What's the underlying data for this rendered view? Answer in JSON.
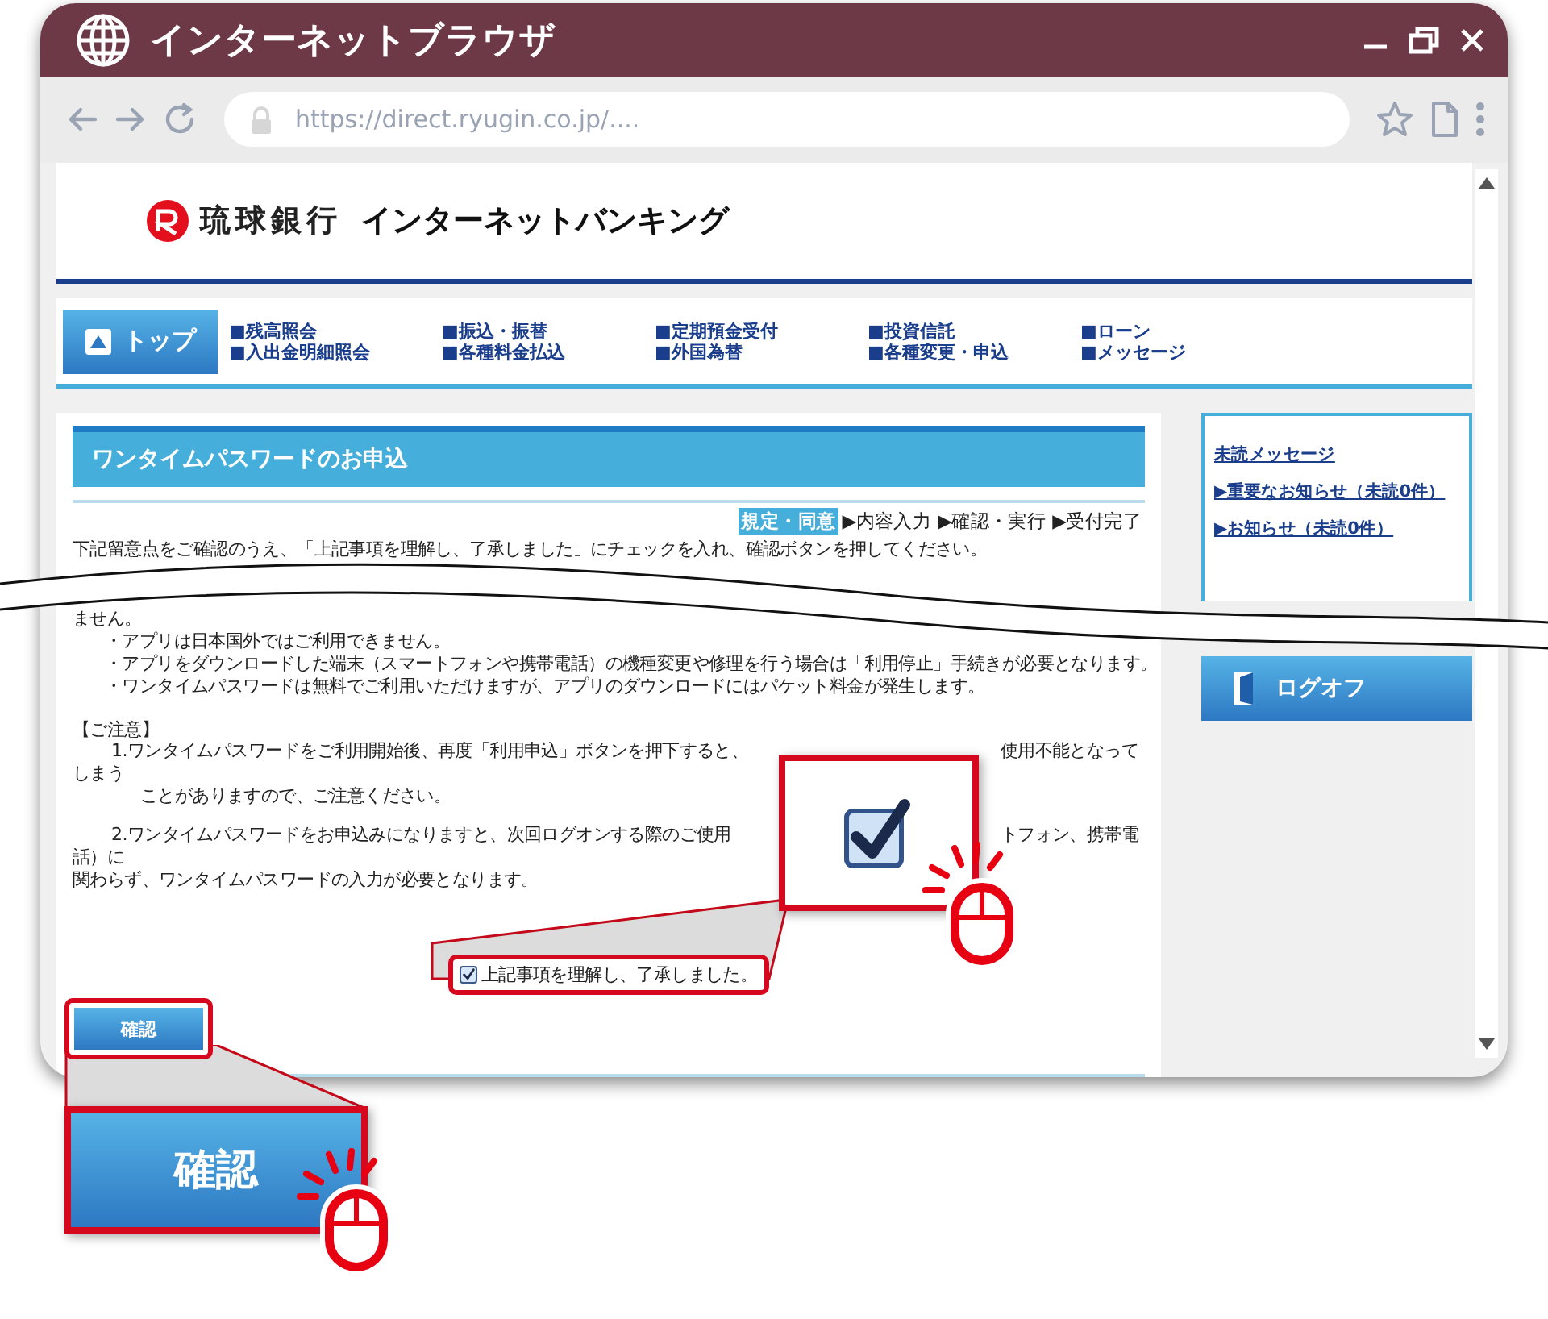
{
  "window": {
    "title": "インターネットブラウザ"
  },
  "address_bar": {
    "url": "https://direct.ryugin.co.jp/...."
  },
  "header": {
    "bank_name": "琉球銀行",
    "service_name": "インターネットバンキング"
  },
  "nav": {
    "top_button": "トップ",
    "columns": [
      [
        "■残高照会",
        "■入出金明細照会"
      ],
      [
        "■振込・振替",
        "■各種料金払込"
      ],
      [
        "■定期預金受付",
        "■外国為替"
      ],
      [
        "■投資信託",
        "■各種変更・申込"
      ],
      [
        "■ローン",
        "■メッセージ"
      ]
    ]
  },
  "form": {
    "title": "ワンタイムパスワードのお申込",
    "steps": [
      {
        "label": "規定・同意",
        "selected": true
      },
      {
        "label": "▶内容入力",
        "selected": false
      },
      {
        "label": "▶確認・実行",
        "selected": false
      },
      {
        "label": "▶受付完了",
        "selected": false
      }
    ],
    "intro": "下記留意点をご確認のうえ、「上記事項を理解し、了承しました」にチェックを入れ、確認ボタンを押してください。",
    "notes": [
      "ません。",
      "・アプリは日本国外ではご利用できません。",
      "・アプリをダウンロードした端末（スマートフォンや携帯電話）の機種変更や修理を行う場合は「利用停止」手続きが必要となります。",
      "・ワンタイムパスワードは無料でご利用いただけますが、アプリのダウンロードにはパケット料金が発生します。"
    ],
    "caution_title": "【ご注意】",
    "caution_lines": [
      {
        "kind": "item",
        "left": "1.ワンタイムパスワードをご利用開始後、再度「利用申込」ボタンを押下すると、",
        "right": "使用不能となって"
      },
      {
        "kind": "wrap",
        "left": "しまう"
      },
      {
        "kind": "continued",
        "left": "ことがありますので、ご注意ください。"
      },
      {
        "kind": "item",
        "left": "2.ワンタイムパスワードをお申込みになりますと、次回ログオンする際のご使用",
        "right": "トフォン、携帯電"
      },
      {
        "kind": "wrap",
        "left": "話）に"
      },
      {
        "kind": "wrap",
        "left": "関わらず、ワンタイムパスワードの入力が必要となります。"
      }
    ],
    "agreement": {
      "label": "上記事項を理解し、了承しました。",
      "checked": true
    },
    "confirm_button": "確認"
  },
  "sidebar": {
    "links": [
      "未読メッセージ",
      "▶重要なお知らせ（未読0件）",
      "▶お知らせ（未読0件）"
    ],
    "logoff": "ログオフ"
  },
  "zoom_callout": {
    "button": "確認"
  }
}
